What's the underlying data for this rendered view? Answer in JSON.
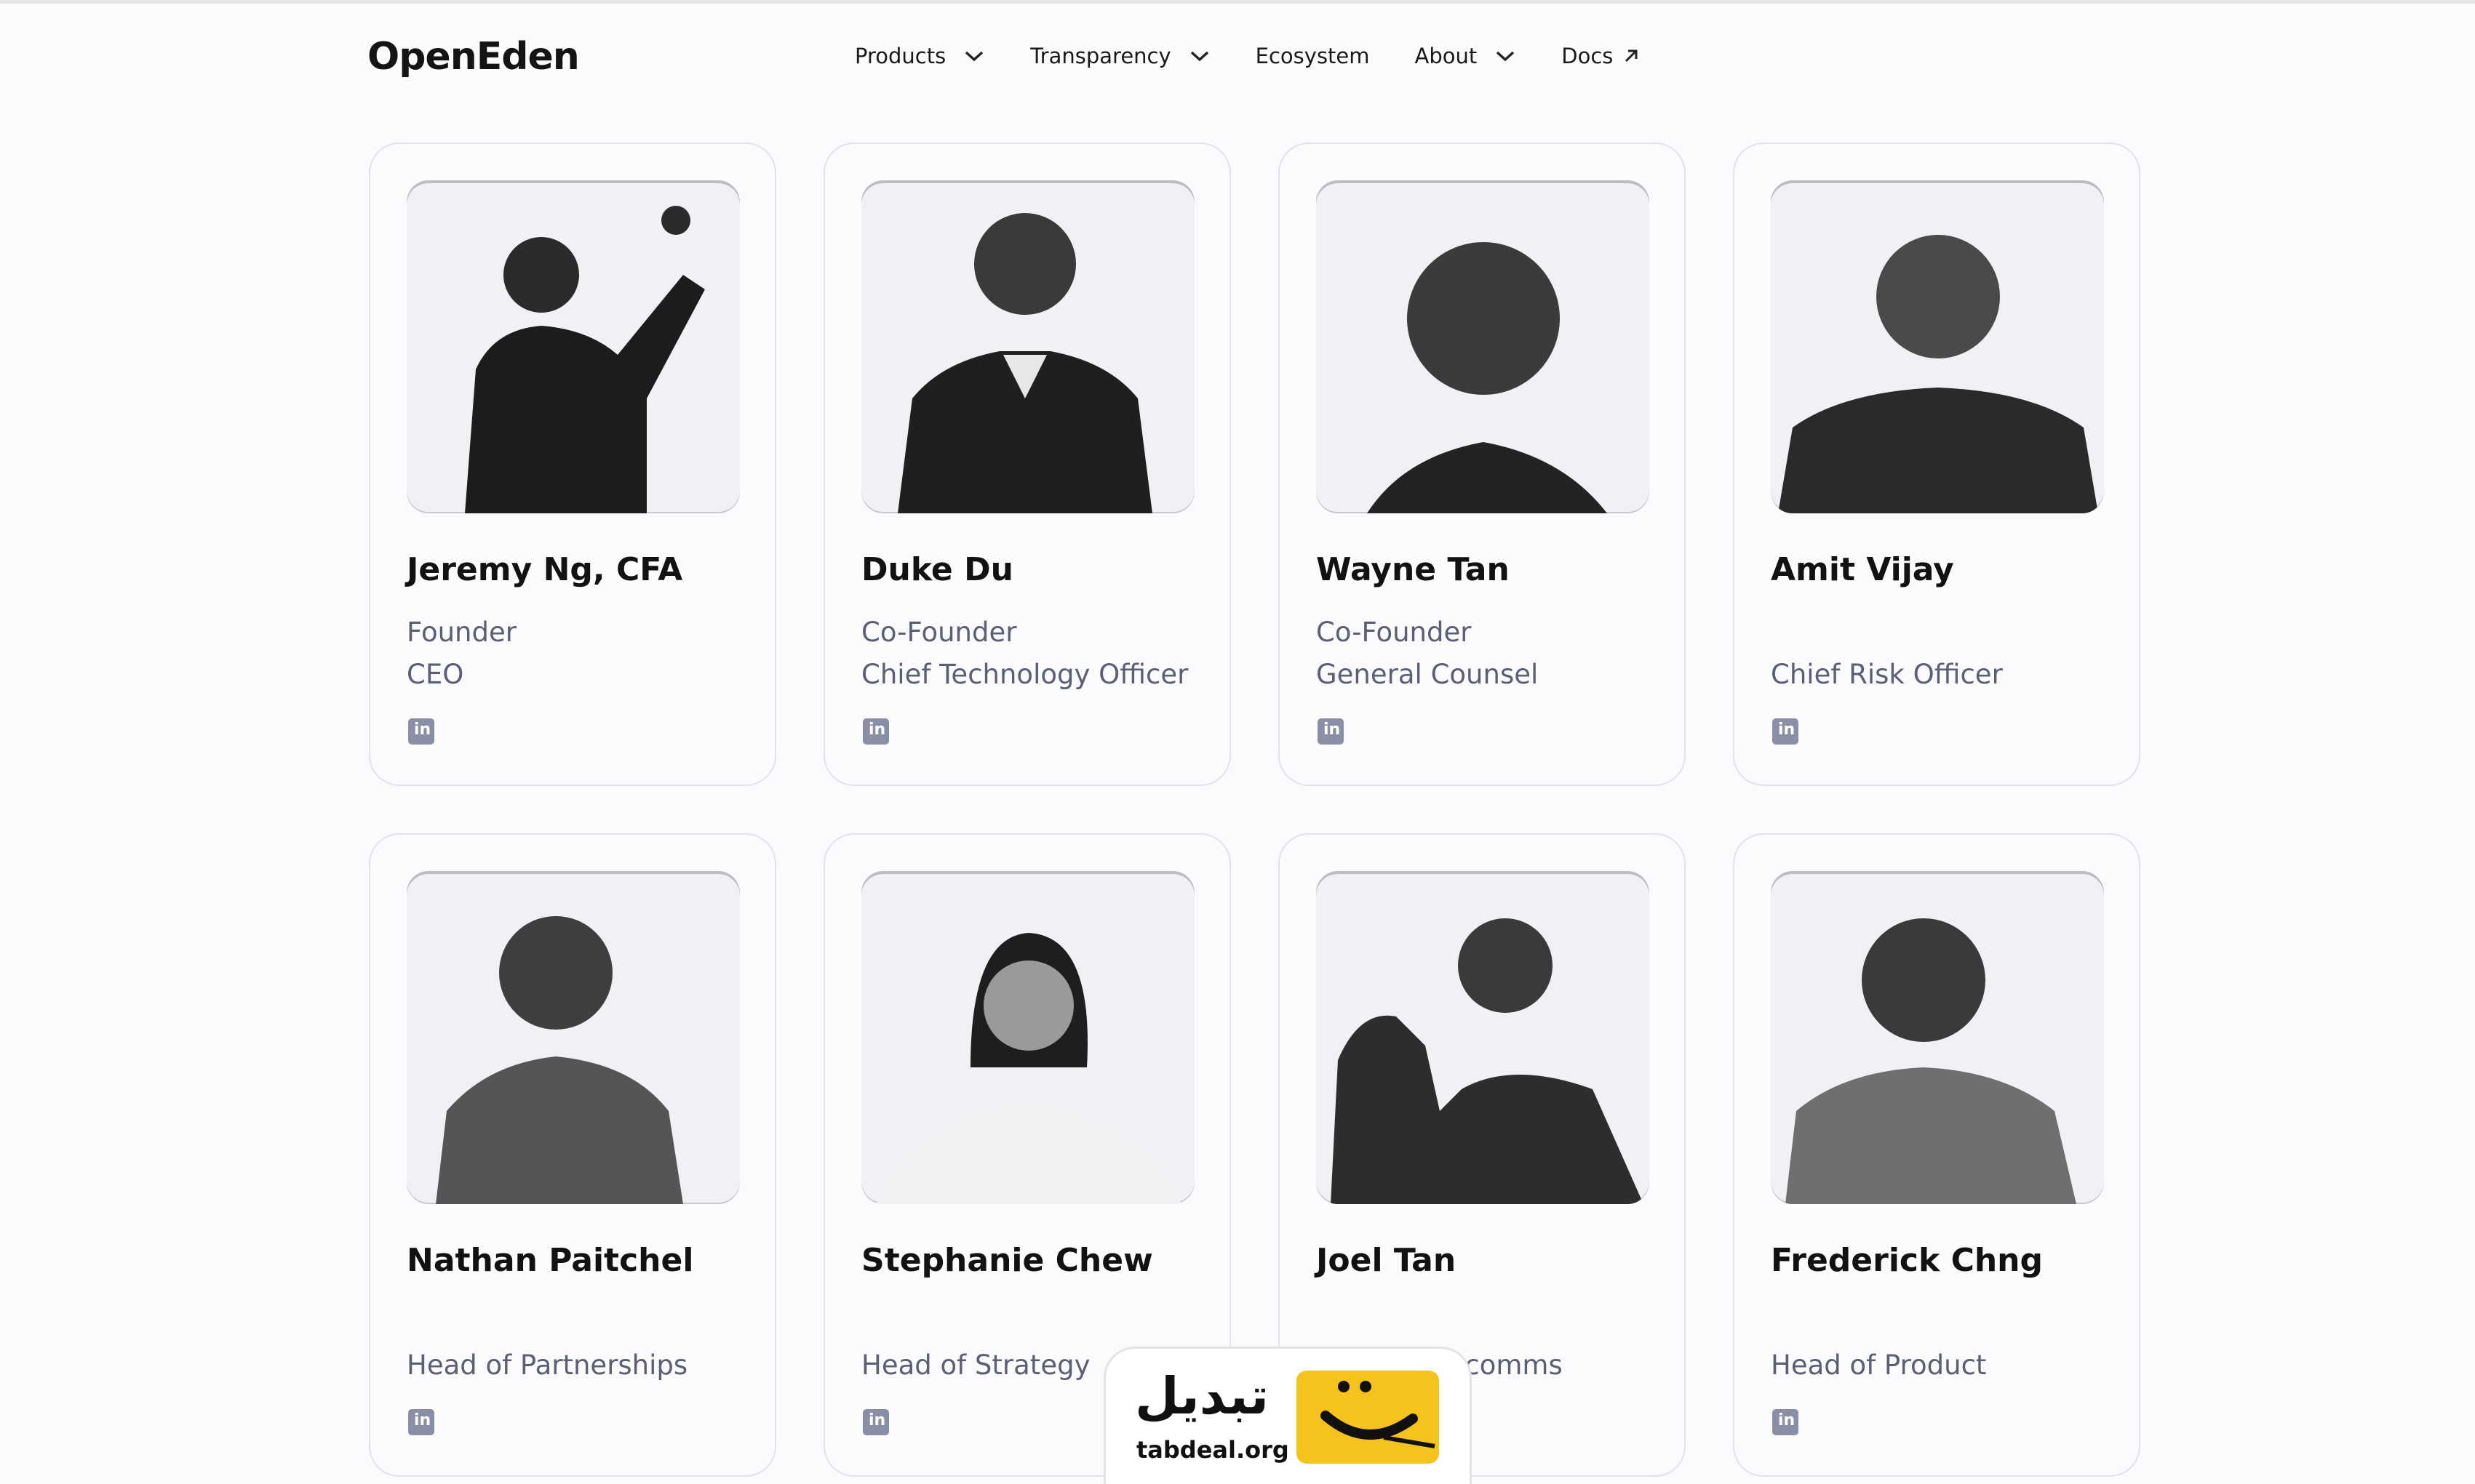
{
  "header": {
    "logo": "OpenEden",
    "nav": [
      {
        "label": "Products",
        "icon": "chevron-down-icon"
      },
      {
        "label": "Transparency",
        "icon": "chevron-down-icon"
      },
      {
        "label": "Ecosystem",
        "icon": ""
      },
      {
        "label": "About",
        "icon": "chevron-down-icon"
      },
      {
        "label": "Docs",
        "icon": "external-link-icon"
      }
    ]
  },
  "team": [
    {
      "name": "Jeremy Ng, CFA",
      "role1": "Founder",
      "role2": "CEO"
    },
    {
      "name": "Duke Du",
      "role1": "Co-Founder",
      "role2": "Chief Technology Officer"
    },
    {
      "name": "Wayne Tan",
      "role1": "Co-Founder",
      "role2": "General Counsel"
    },
    {
      "name": "Amit Vijay",
      "role1": "",
      "role2": "Chief Risk Officer"
    },
    {
      "name": "Nathan Paitchel",
      "role1": "",
      "role2": "Head of Partnerships"
    },
    {
      "name": "Stephanie Chew",
      "role1": "",
      "role2": "Head of Strategy"
    },
    {
      "name": "Joel Tan",
      "role1": "",
      "role2": "rcomms"
    },
    {
      "name": "Frederick Chng",
      "role1": "",
      "role2": "Head of Product"
    }
  ],
  "linkedin_label": "in",
  "watermark": {
    "brand_fa": "تبدیل",
    "domain": "tabdeal.org"
  },
  "colors": {
    "accent_text": "#5a5f74",
    "linkedin": "#8b8fa6",
    "watermark_yellow": "#f6c21c"
  }
}
